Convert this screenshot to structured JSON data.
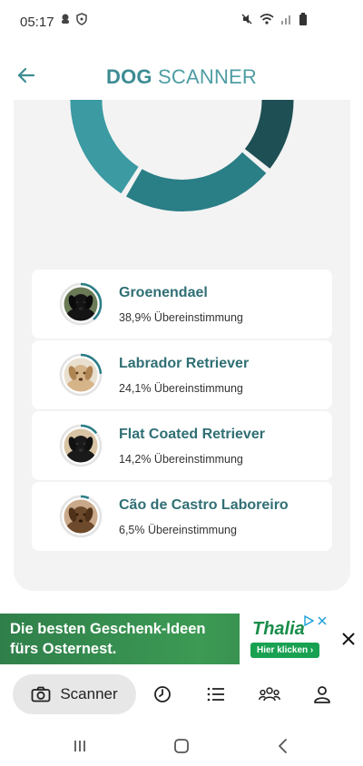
{
  "status": {
    "time": "05:17"
  },
  "header": {
    "title_bold": "DOG",
    "title_light": " SCANNER"
  },
  "chart_data": {
    "type": "pie",
    "donut": true,
    "values": [
      38.9,
      24.1,
      14.2,
      6.5
    ],
    "categories": [
      "Groenendael",
      "Labrador Retriever",
      "Flat Coated Retriever",
      "Cão de Castro Laboreiro"
    ],
    "colors": [
      "#1e4f54",
      "#2a7e86",
      "#3b9aa2",
      "#7cc0c6"
    ]
  },
  "results": [
    {
      "name": "Groenendael",
      "match": "38,9% Übereinstimmung",
      "fraction": 0.389,
      "avatar": "black-dog"
    },
    {
      "name": "Labrador Retriever",
      "match": "24,1% Übereinstimmung",
      "fraction": 0.241,
      "avatar": "golden-dog"
    },
    {
      "name": "Flat Coated Retriever",
      "match": "14,2% Übereinstimmung",
      "fraction": 0.142,
      "avatar": "black-retriever"
    },
    {
      "name": "Cão de Castro Laboreiro",
      "match": "6,5% Übereinstimmung",
      "fraction": 0.065,
      "avatar": "brown-dog"
    }
  ],
  "ad": {
    "line1": "Die besten Geschenk-Ideen",
    "line2": "fürs Osternest.",
    "logo": "Thalia",
    "cta": "Hier klicken ›"
  },
  "nav": {
    "scanner_label": "Scanner"
  }
}
